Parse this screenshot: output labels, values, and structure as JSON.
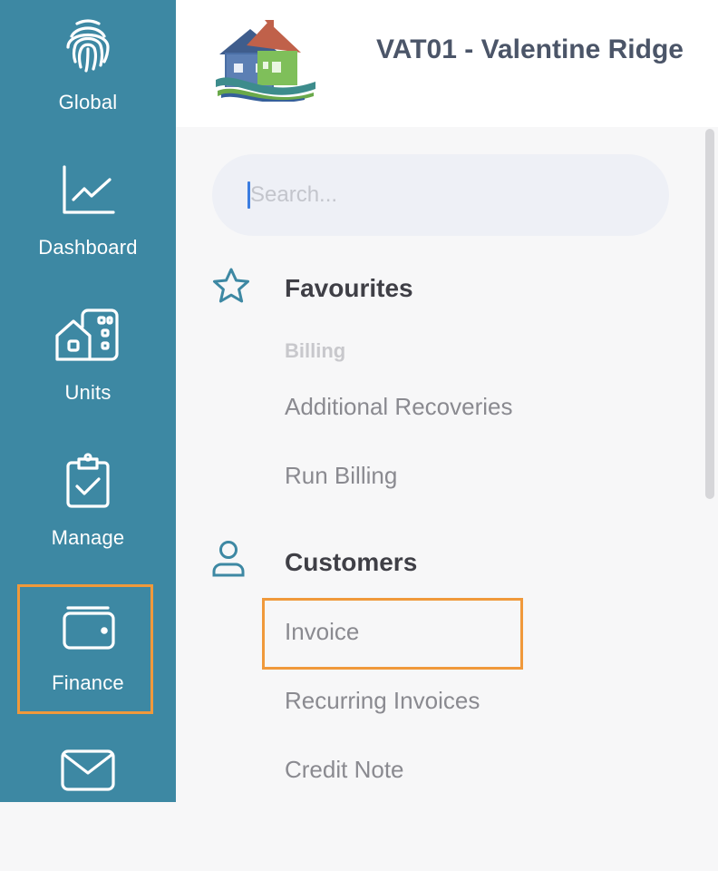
{
  "colors": {
    "rail_bg": "#3d88a3",
    "highlight": "#f0993b",
    "title": "#4b5568",
    "link": "#8a8a90",
    "search_bg": "#eef0f6"
  },
  "rail": {
    "items": [
      {
        "label": "Global",
        "icon": "fingerprint-icon"
      },
      {
        "label": "Dashboard",
        "icon": "line-chart-icon"
      },
      {
        "label": "Units",
        "icon": "buildings-icon"
      },
      {
        "label": "Manage",
        "icon": "clipboard-check-icon"
      },
      {
        "label": "Finance",
        "icon": "wallet-icon",
        "highlighted": true
      },
      {
        "label": "",
        "icon": "mail-icon"
      }
    ]
  },
  "header": {
    "title": "VAT01 - Valentine Ridge"
  },
  "search": {
    "placeholder": "Search...",
    "value": ""
  },
  "sections": {
    "favourites": {
      "title": "Favourites",
      "icon": "star-icon",
      "group_label": "Billing",
      "links": [
        "Additional Recoveries",
        "Run Billing"
      ]
    },
    "customers": {
      "title": "Customers",
      "icon": "user-icon",
      "links": [
        "Invoice",
        "Recurring Invoices",
        "Credit Note"
      ],
      "highlighted_link": "Invoice"
    }
  }
}
